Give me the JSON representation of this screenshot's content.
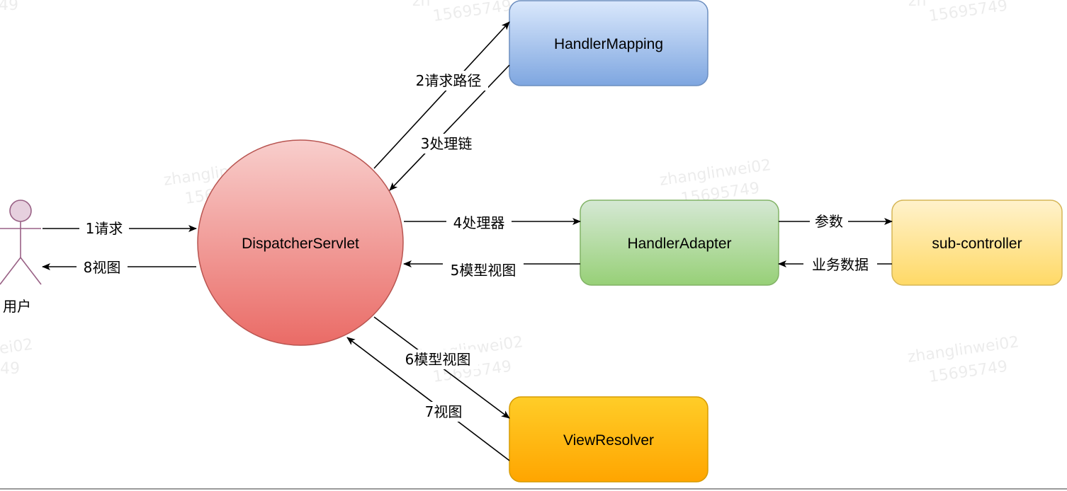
{
  "nodes": {
    "user": "用户",
    "dispatcher": "DispatcherServlet",
    "handler_mapping": "HandlerMapping",
    "handler_adapter": "HandlerAdapter",
    "sub_controller": "sub-controller",
    "view_resolver": "ViewResolver"
  },
  "edges": {
    "e1": "1请求",
    "e2": "2请求路径",
    "e3": "3处理链",
    "e4": "4处理器",
    "e5": "5模型视图",
    "e6": "6模型视图",
    "e7": "7视图",
    "e8": "8视图",
    "params": "参数",
    "business": "业务数据"
  },
  "watermark": {
    "name": "zhanglinwei02",
    "number": "15695749",
    "name_fragment_left": "ei02",
    "number_fragment_left": "49",
    "name_fragment_top": "zh",
    "number_fragment_top_left": "15695749",
    "name_fragment_top_right": "zh"
  },
  "colors": {
    "dispatcher_fill_top": "#f8cecc",
    "dispatcher_fill_bottom": "#ea6b66",
    "dispatcher_stroke": "#b85450",
    "mapping_fill_top": "#dae8fc",
    "mapping_fill_bottom": "#7ea6e0",
    "mapping_stroke": "#6c8ebf",
    "adapter_fill_top": "#d5e8d4",
    "adapter_fill_bottom": "#97d077",
    "adapter_stroke": "#82b366",
    "sub_fill_top": "#fff2cc",
    "sub_fill_bottom": "#ffd966",
    "sub_stroke": "#d6b656",
    "view_fill_top": "#ffcd28",
    "view_fill_bottom": "#ffa500",
    "view_stroke": "#d79b00",
    "actor_fill": "#e6d0de",
    "actor_stroke": "#996185"
  }
}
